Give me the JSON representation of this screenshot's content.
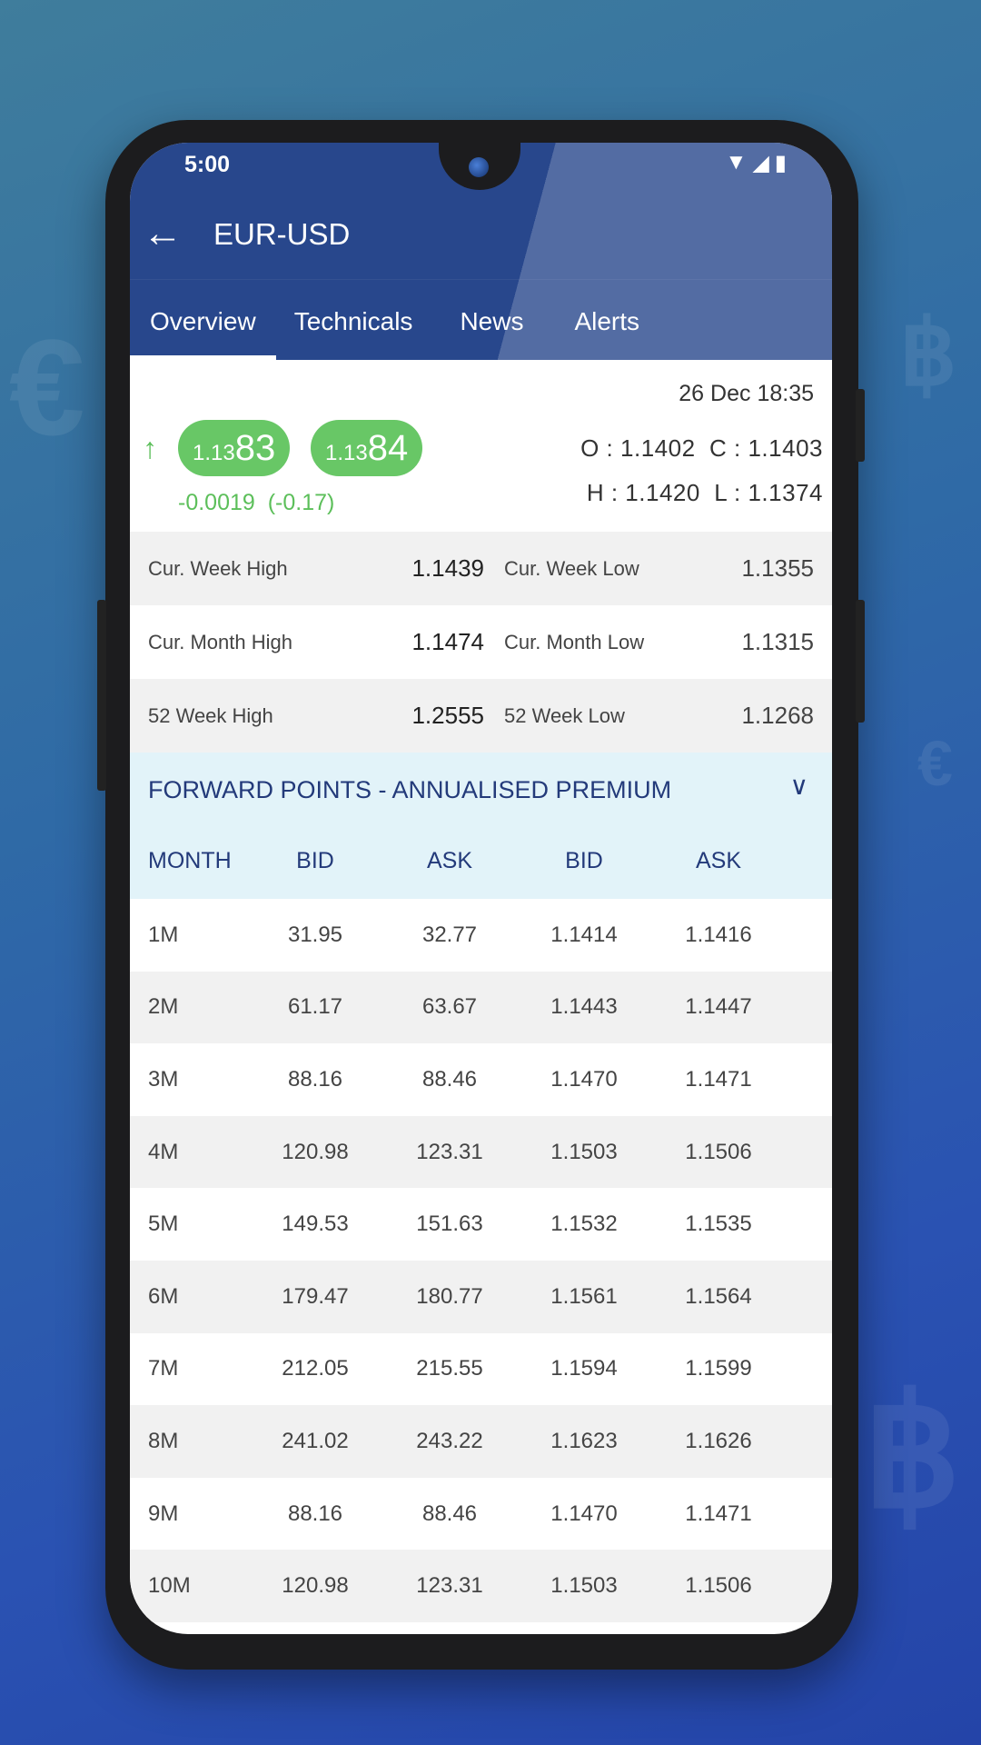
{
  "status_bar": {
    "time": "5:00"
  },
  "header": {
    "title": "EUR-USD"
  },
  "tabs": [
    {
      "label": "Overview"
    },
    {
      "label": "Technicals"
    },
    {
      "label": "News"
    },
    {
      "label": "Alerts"
    }
  ],
  "quote": {
    "date": "26 Dec 18:35",
    "bid_prefix": "1.13",
    "bid_big": "83",
    "ask_prefix": "1.13",
    "ask_big": "84",
    "change": "-0.0019",
    "change_pct": "(-0.17)",
    "open_label": "O :",
    "open": "1.1402",
    "close_label": "C :",
    "close": "1.1403",
    "high_label": "H :",
    "high": "1.1420",
    "low_label": "L :",
    "low": "1.1374"
  },
  "stats": [
    {
      "l1": "Cur. Week High",
      "v1": "1.1439",
      "l2": "Cur. Week Low",
      "v2": "1.1355"
    },
    {
      "l1": "Cur. Month High",
      "v1": "1.1474",
      "l2": "Cur. Month Low",
      "v2": "1.1315"
    },
    {
      "l1": "52 Week High",
      "v1": "1.2555",
      "l2": "52 Week Low",
      "v2": "1.1268"
    }
  ],
  "forward": {
    "title": "FORWARD POINTS - ANNUALISED PREMIUM",
    "columns": [
      "MONTH",
      "BID",
      "ASK",
      "BID",
      "ASK"
    ],
    "rows": [
      [
        "1M",
        "31.95",
        "32.77",
        "1.1414",
        "1.1416"
      ],
      [
        "2M",
        "61.17",
        "63.67",
        "1.1443",
        "1.1447"
      ],
      [
        "3M",
        "88.16",
        "88.46",
        "1.1470",
        "1.1471"
      ],
      [
        "4M",
        "120.98",
        "123.31",
        "1.1503",
        "1.1506"
      ],
      [
        "5M",
        "149.53",
        "151.63",
        "1.1532",
        "1.1535"
      ],
      [
        "6M",
        "179.47",
        "180.77",
        "1.1561",
        "1.1564"
      ],
      [
        "7M",
        "212.05",
        "215.55",
        "1.1594",
        "1.1599"
      ],
      [
        "8M",
        "241.02",
        "243.22",
        "1.1623",
        "1.1626"
      ],
      [
        "9M",
        "88.16",
        "88.46",
        "1.1470",
        "1.1471"
      ],
      [
        "10M",
        "120.98",
        "123.31",
        "1.1503",
        "1.1506"
      ]
    ]
  },
  "colors": {
    "header": "#28478c",
    "green": "#68c766",
    "navy_text": "#233a7a",
    "forward_bg": "#e2f3f9"
  }
}
